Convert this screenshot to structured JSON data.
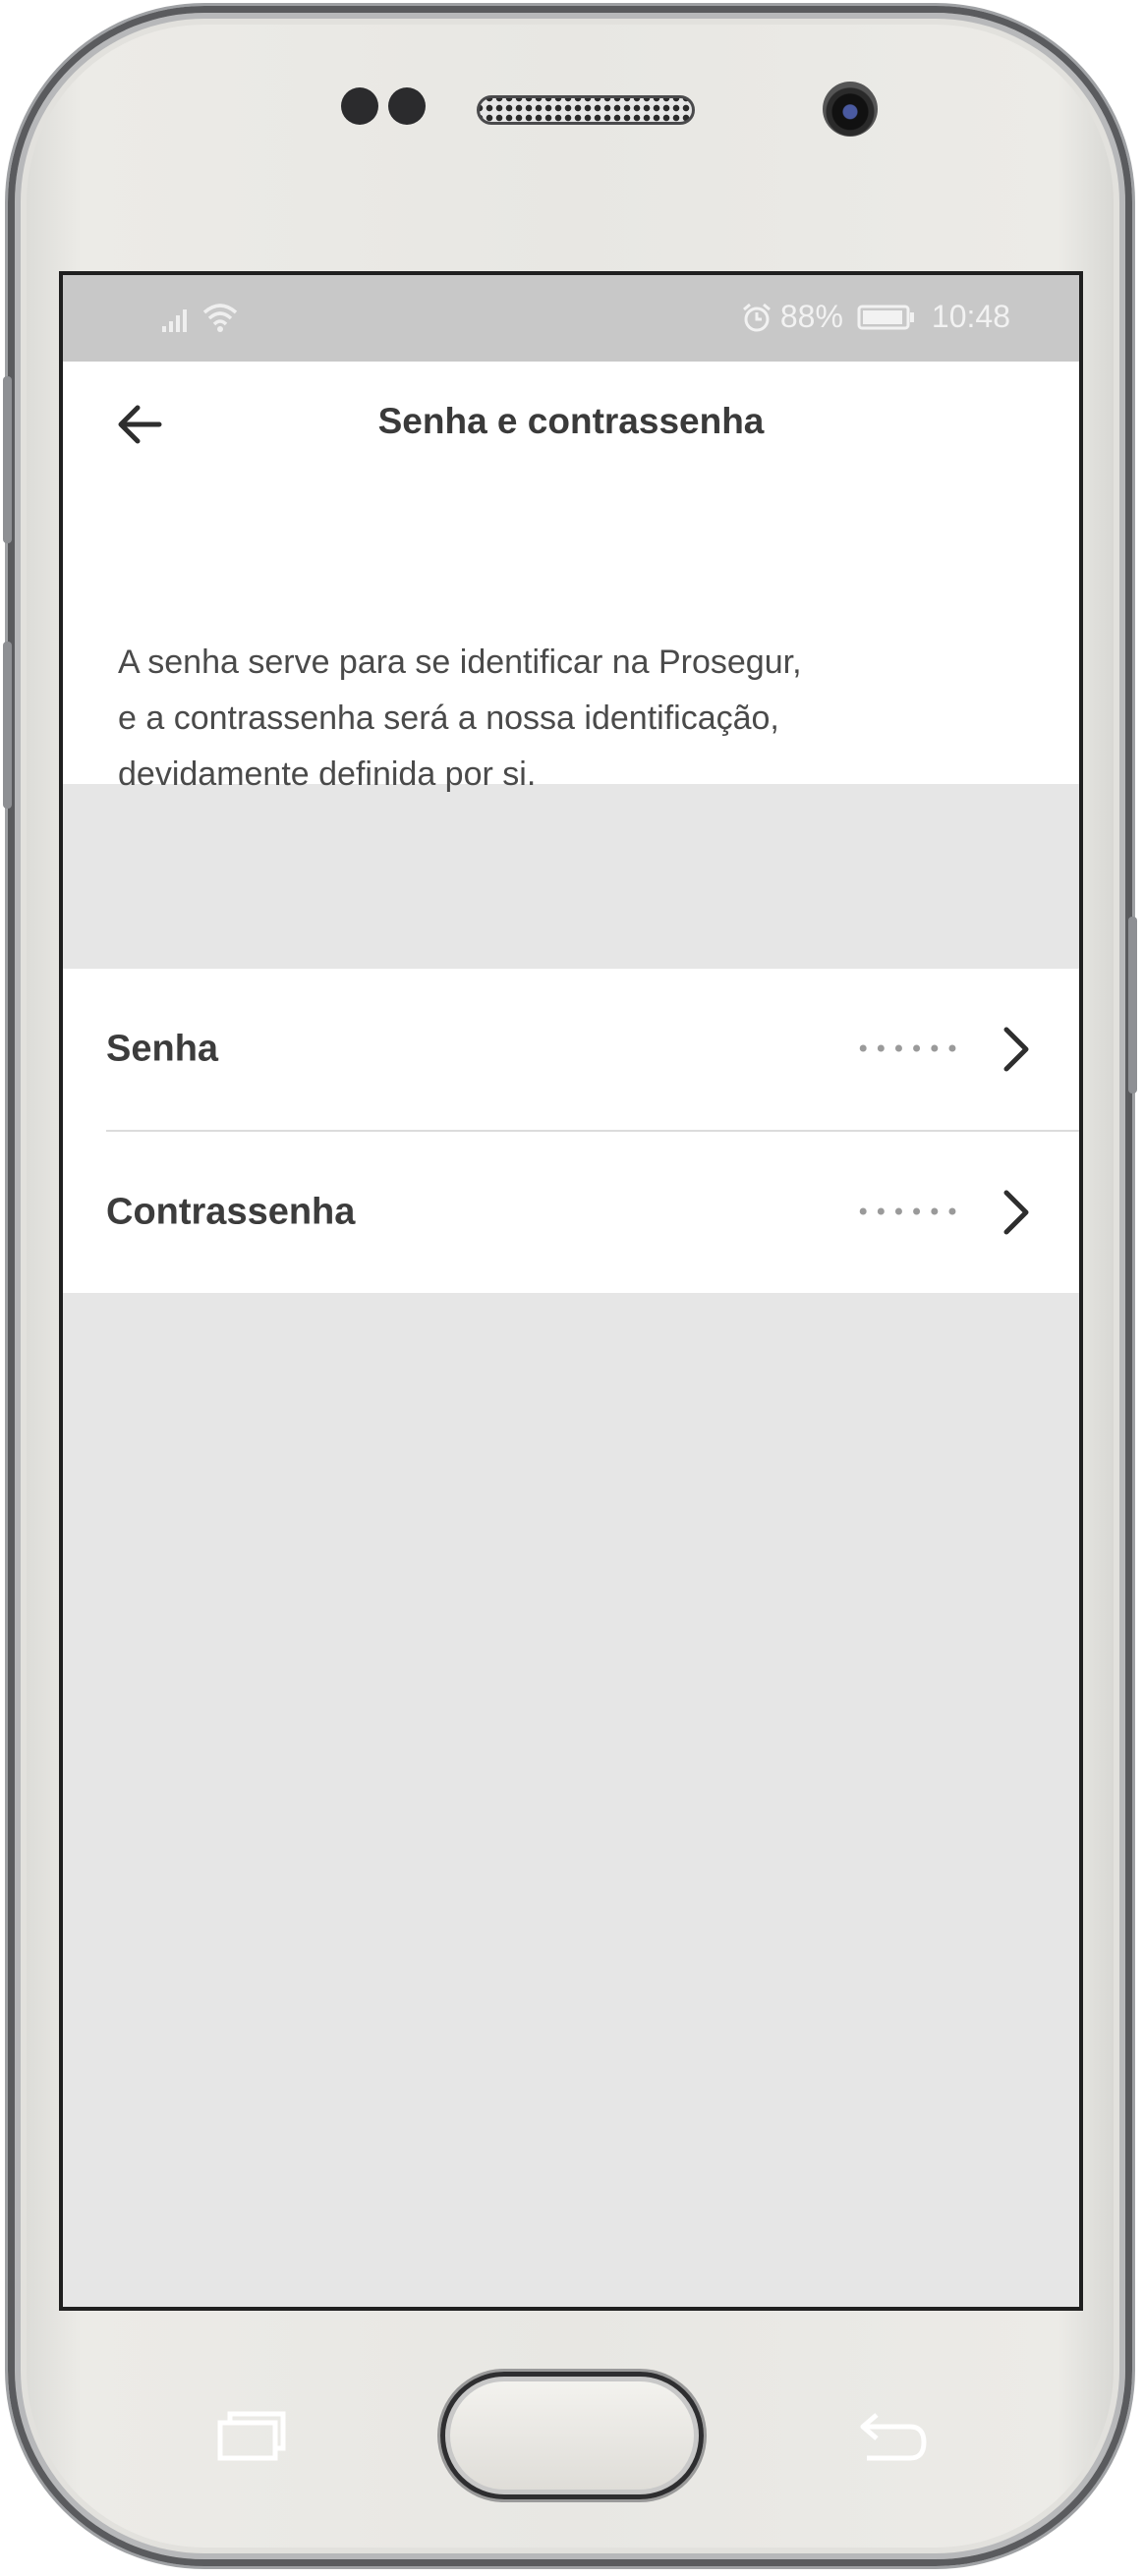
{
  "status_bar": {
    "battery": "88%",
    "time": "10:48",
    "icons": [
      "signal-icon",
      "wifi-icon",
      "alarm-icon",
      "battery-icon"
    ]
  },
  "header": {
    "title": "Senha e contrassenha",
    "back_icon": "arrow-left-icon"
  },
  "description": {
    "lines": [
      "A senha serve para se identificar na Prosegur,",
      "e a contrassenha será a nossa identificação,",
      "devidamente definida por si."
    ]
  },
  "settings": [
    {
      "label": "Senha",
      "value": "••••••",
      "icon": "chevron-right-icon"
    },
    {
      "label": "Contrassenha",
      "value": "••••••",
      "icon": "chevron-right-icon"
    }
  ],
  "colors": {
    "background": "#e6e6e6",
    "surface": "#ffffff",
    "text_primary": "#3a3a3a",
    "status_bar": "#c8c8c8"
  }
}
